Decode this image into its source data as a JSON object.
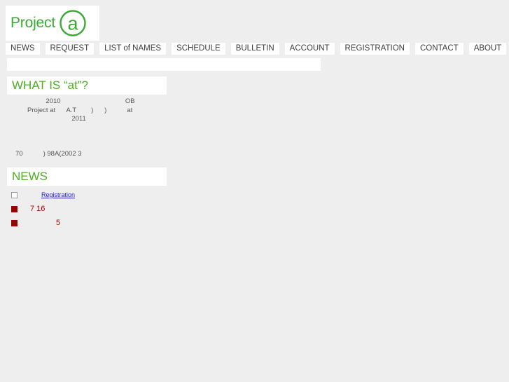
{
  "site": {
    "logo_word": "Project",
    "logo_mark_letter": "a",
    "brand_green": "#3aaa35",
    "heading_green": "#4caf22",
    "news_red": "#990000",
    "link_blue": "#2222cc",
    "background": "#eeeeee"
  },
  "nav": {
    "items": [
      {
        "label": "NEWS"
      },
      {
        "label": "REQUEST"
      },
      {
        "label": "LIST of NAMES"
      },
      {
        "label": "SCHEDULE"
      },
      {
        "label": "BULLETIN"
      },
      {
        "label": "ACCOUNT"
      },
      {
        "label": "REGISTRATION"
      },
      {
        "label": "CONTACT"
      },
      {
        "label": "ABOUT"
      }
    ]
  },
  "sections": {
    "what_is": {
      "heading": "WHAT IS “at”?",
      "paragraph_line_1": "          2010                                   OB\nProject at      A.T        )      )           at\n                        2011",
      "paragraph_line_2": "70           ) 98A(2002 3"
    },
    "news": {
      "heading": "NEWS",
      "items": [
        {
          "bullet": "hollow",
          "label": "Registration"
        },
        {
          "bullet": "solid",
          "label": "7 16"
        },
        {
          "bullet": "solid",
          "label": "5"
        }
      ]
    }
  }
}
